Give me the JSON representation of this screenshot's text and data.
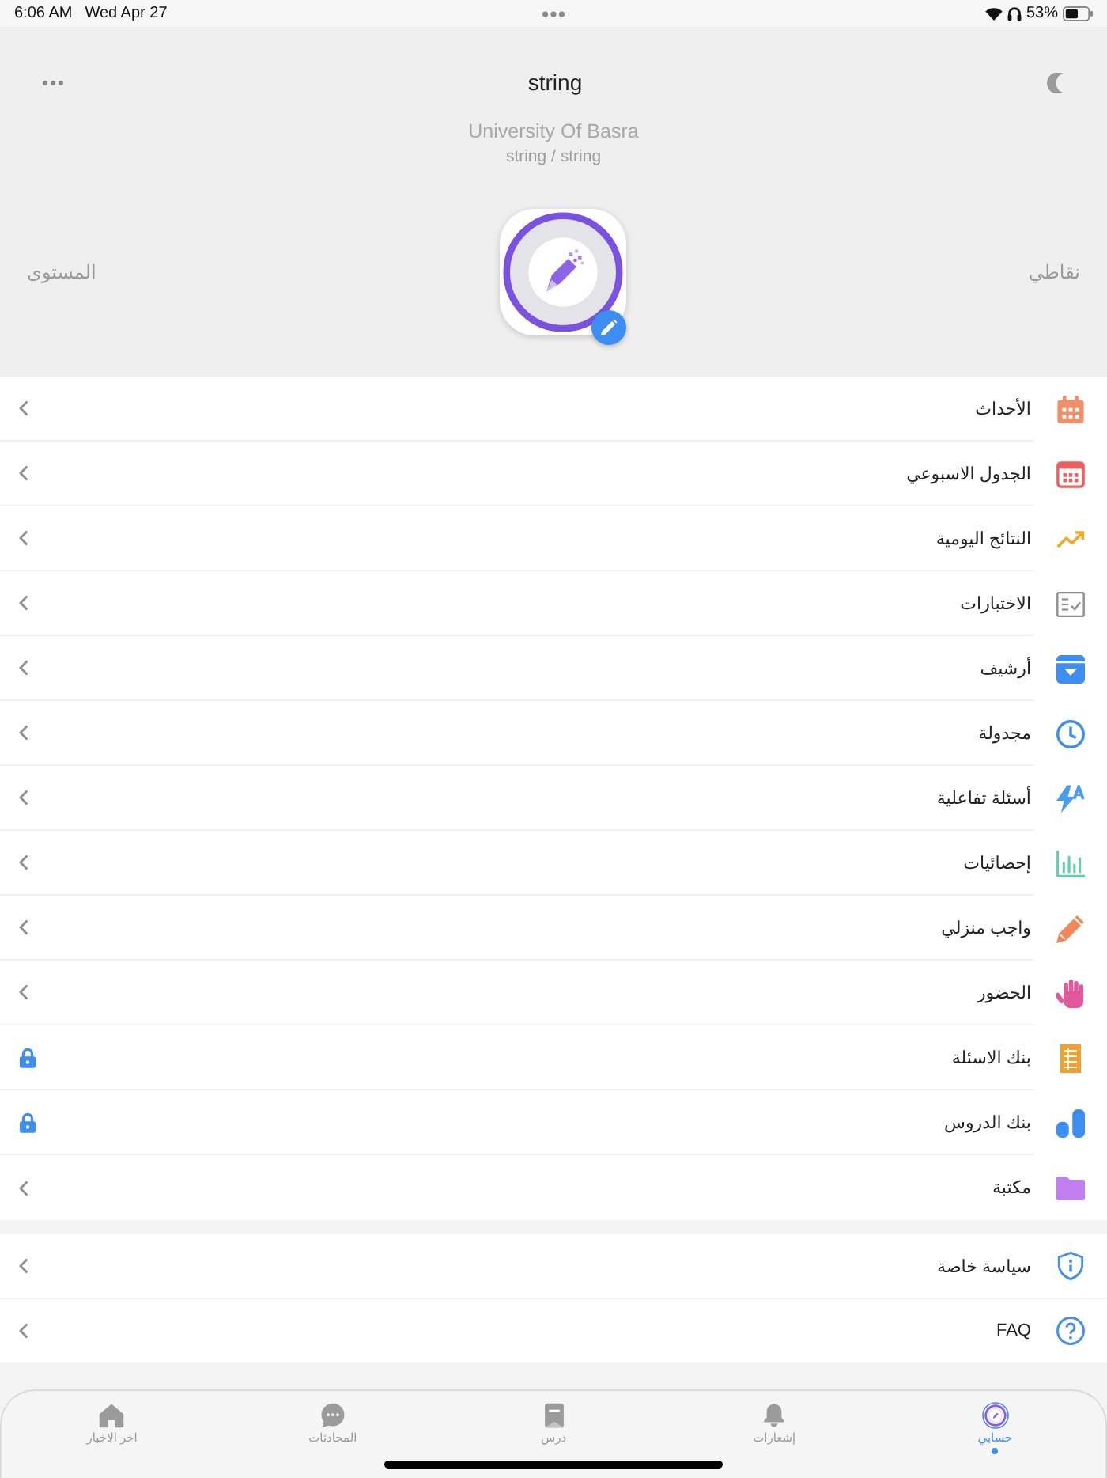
{
  "status_bar": {
    "time": "6:06 AM",
    "date": "Wed Apr 27",
    "battery": "53%"
  },
  "header": {
    "title": "string",
    "organization": "University Of Basra",
    "subtitle": "string / string",
    "left_label": "المستوى",
    "right_label": "نقاطي"
  },
  "menu": [
    {
      "label": "الأحداث",
      "kind": "calendar",
      "color": "#f0906a",
      "locked": false
    },
    {
      "label": "الجدول الاسبوعي",
      "kind": "calendar-grid",
      "color": "#e8605f",
      "locked": false
    },
    {
      "label": "النتائج اليومية",
      "kind": "trend",
      "color": "#f5a623",
      "locked": false
    },
    {
      "label": "الاختبارات",
      "kind": "checklist",
      "color": "#8e8e93",
      "locked": false
    },
    {
      "label": "أرشيف",
      "kind": "archive",
      "color": "#3d8ef0",
      "locked": false
    },
    {
      "label": "مجدولة",
      "kind": "clock",
      "color": "#3d8ef0",
      "locked": false
    },
    {
      "label": "أسئلة تفاعلية",
      "kind": "lightning",
      "color": "#4a9cf0",
      "locked": false
    },
    {
      "label": "إحصائيات",
      "kind": "bars",
      "color": "#5fd0a8",
      "locked": false
    },
    {
      "label": "واجب منزلي",
      "kind": "pencil",
      "color": "#f0885a",
      "locked": false
    },
    {
      "label": "الحضور",
      "kind": "hand",
      "color": "#e2589c",
      "locked": false
    },
    {
      "label": "بنك الاسئلة",
      "kind": "ledger",
      "color": "#f0a030",
      "locked": true
    },
    {
      "label": "بنك الدروس",
      "kind": "blocks",
      "color": "#3d8ef0",
      "locked": true
    },
    {
      "label": "مكتبة",
      "kind": "folder",
      "color": "#c07ef0",
      "locked": false
    }
  ],
  "secondary_menu": [
    {
      "label": "سياسة خاصة",
      "kind": "shield",
      "color": "#4a90e2",
      "locked": false
    },
    {
      "label": "FAQ",
      "kind": "question",
      "color": "#4a90e2",
      "locked": false
    }
  ],
  "tab_bar": [
    {
      "label": "حسابي",
      "kind": "profile",
      "selected": true
    },
    {
      "label": "إشعارات",
      "kind": "bell",
      "selected": false
    },
    {
      "label": "درس",
      "kind": "lesson",
      "selected": false
    },
    {
      "label": "المحادثات",
      "kind": "chat",
      "selected": false
    },
    {
      "label": "اخر الاخبار",
      "kind": "home",
      "selected": false
    }
  ]
}
